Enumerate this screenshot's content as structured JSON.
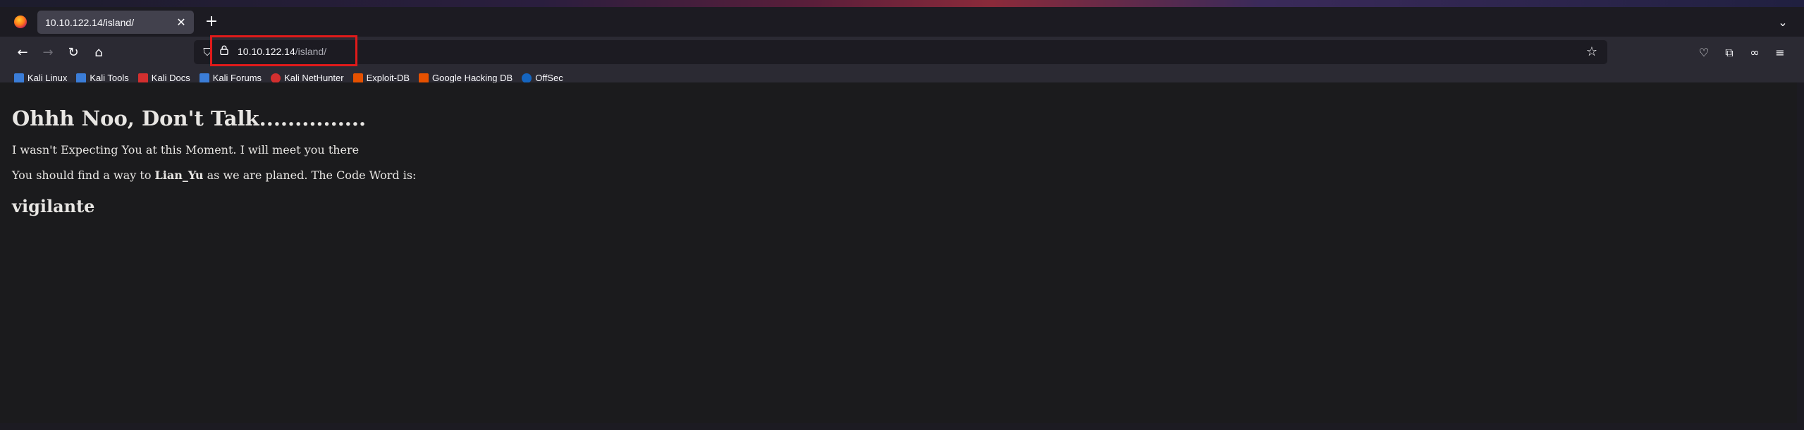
{
  "browser": {
    "tab_title": "10.10.122.14/island/",
    "tab_close": "✕",
    "new_tab": "+",
    "url_host": "10.10.122.14",
    "url_path": "/island/"
  },
  "bookmarks": [
    {
      "label": "Kali Linux",
      "color": "#3b7dd8"
    },
    {
      "label": "Kali Tools",
      "color": "#3b7dd8"
    },
    {
      "label": "Kali Docs",
      "color": "#d32f2f"
    },
    {
      "label": "Kali Forums",
      "color": "#3b7dd8"
    },
    {
      "label": "Kali NetHunter",
      "color": "#d32f2f"
    },
    {
      "label": "Exploit-DB",
      "color": "#e65100"
    },
    {
      "label": "Google Hacking DB",
      "color": "#e65100"
    },
    {
      "label": "OffSec",
      "color": "#1565c0"
    }
  ],
  "page": {
    "heading": "Ohhh Noo, Don't Talk...............",
    "line1": "I wasn't Expecting You at this Moment. I will meet you there",
    "line2_prefix": "You should find a way to ",
    "line2_bold": "Lian_Yu",
    "line2_suffix": " as we are planed. The Code Word is:",
    "code_word": "vigilante"
  },
  "colors": {
    "highlight": "#e01a1a",
    "page_bg": "#1b1b1d",
    "toolbar_bg": "#2b2a33"
  }
}
